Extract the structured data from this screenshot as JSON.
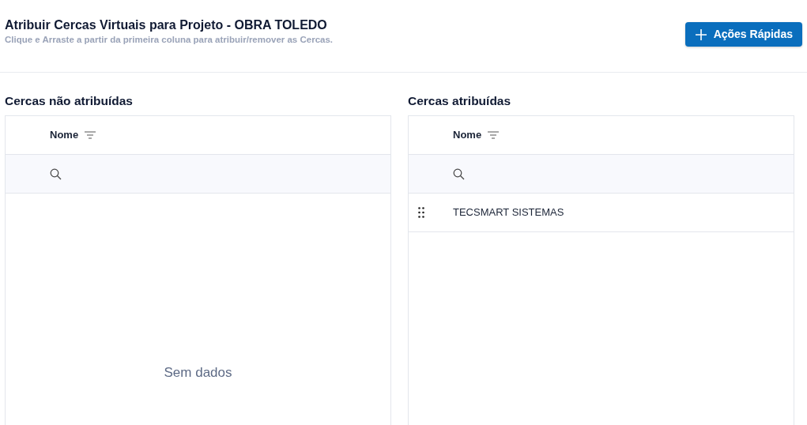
{
  "header": {
    "title": "Atribuir Cercas Virtuais para Projeto - OBRA TOLEDO",
    "subtitle": "Clique e Arraste a partir da primeira coluna para atribuir/remover as Cercas.",
    "action_button": "Ações Rápidas"
  },
  "panels": [
    {
      "title": "Cercas não atribuídas",
      "column": "Nome",
      "empty_text": "Sem dados"
    },
    {
      "title": "Cercas atribuídas",
      "column": "Nome",
      "rows": [
        {
          "name": "TECSMART SISTEMAS"
        }
      ]
    }
  ]
}
